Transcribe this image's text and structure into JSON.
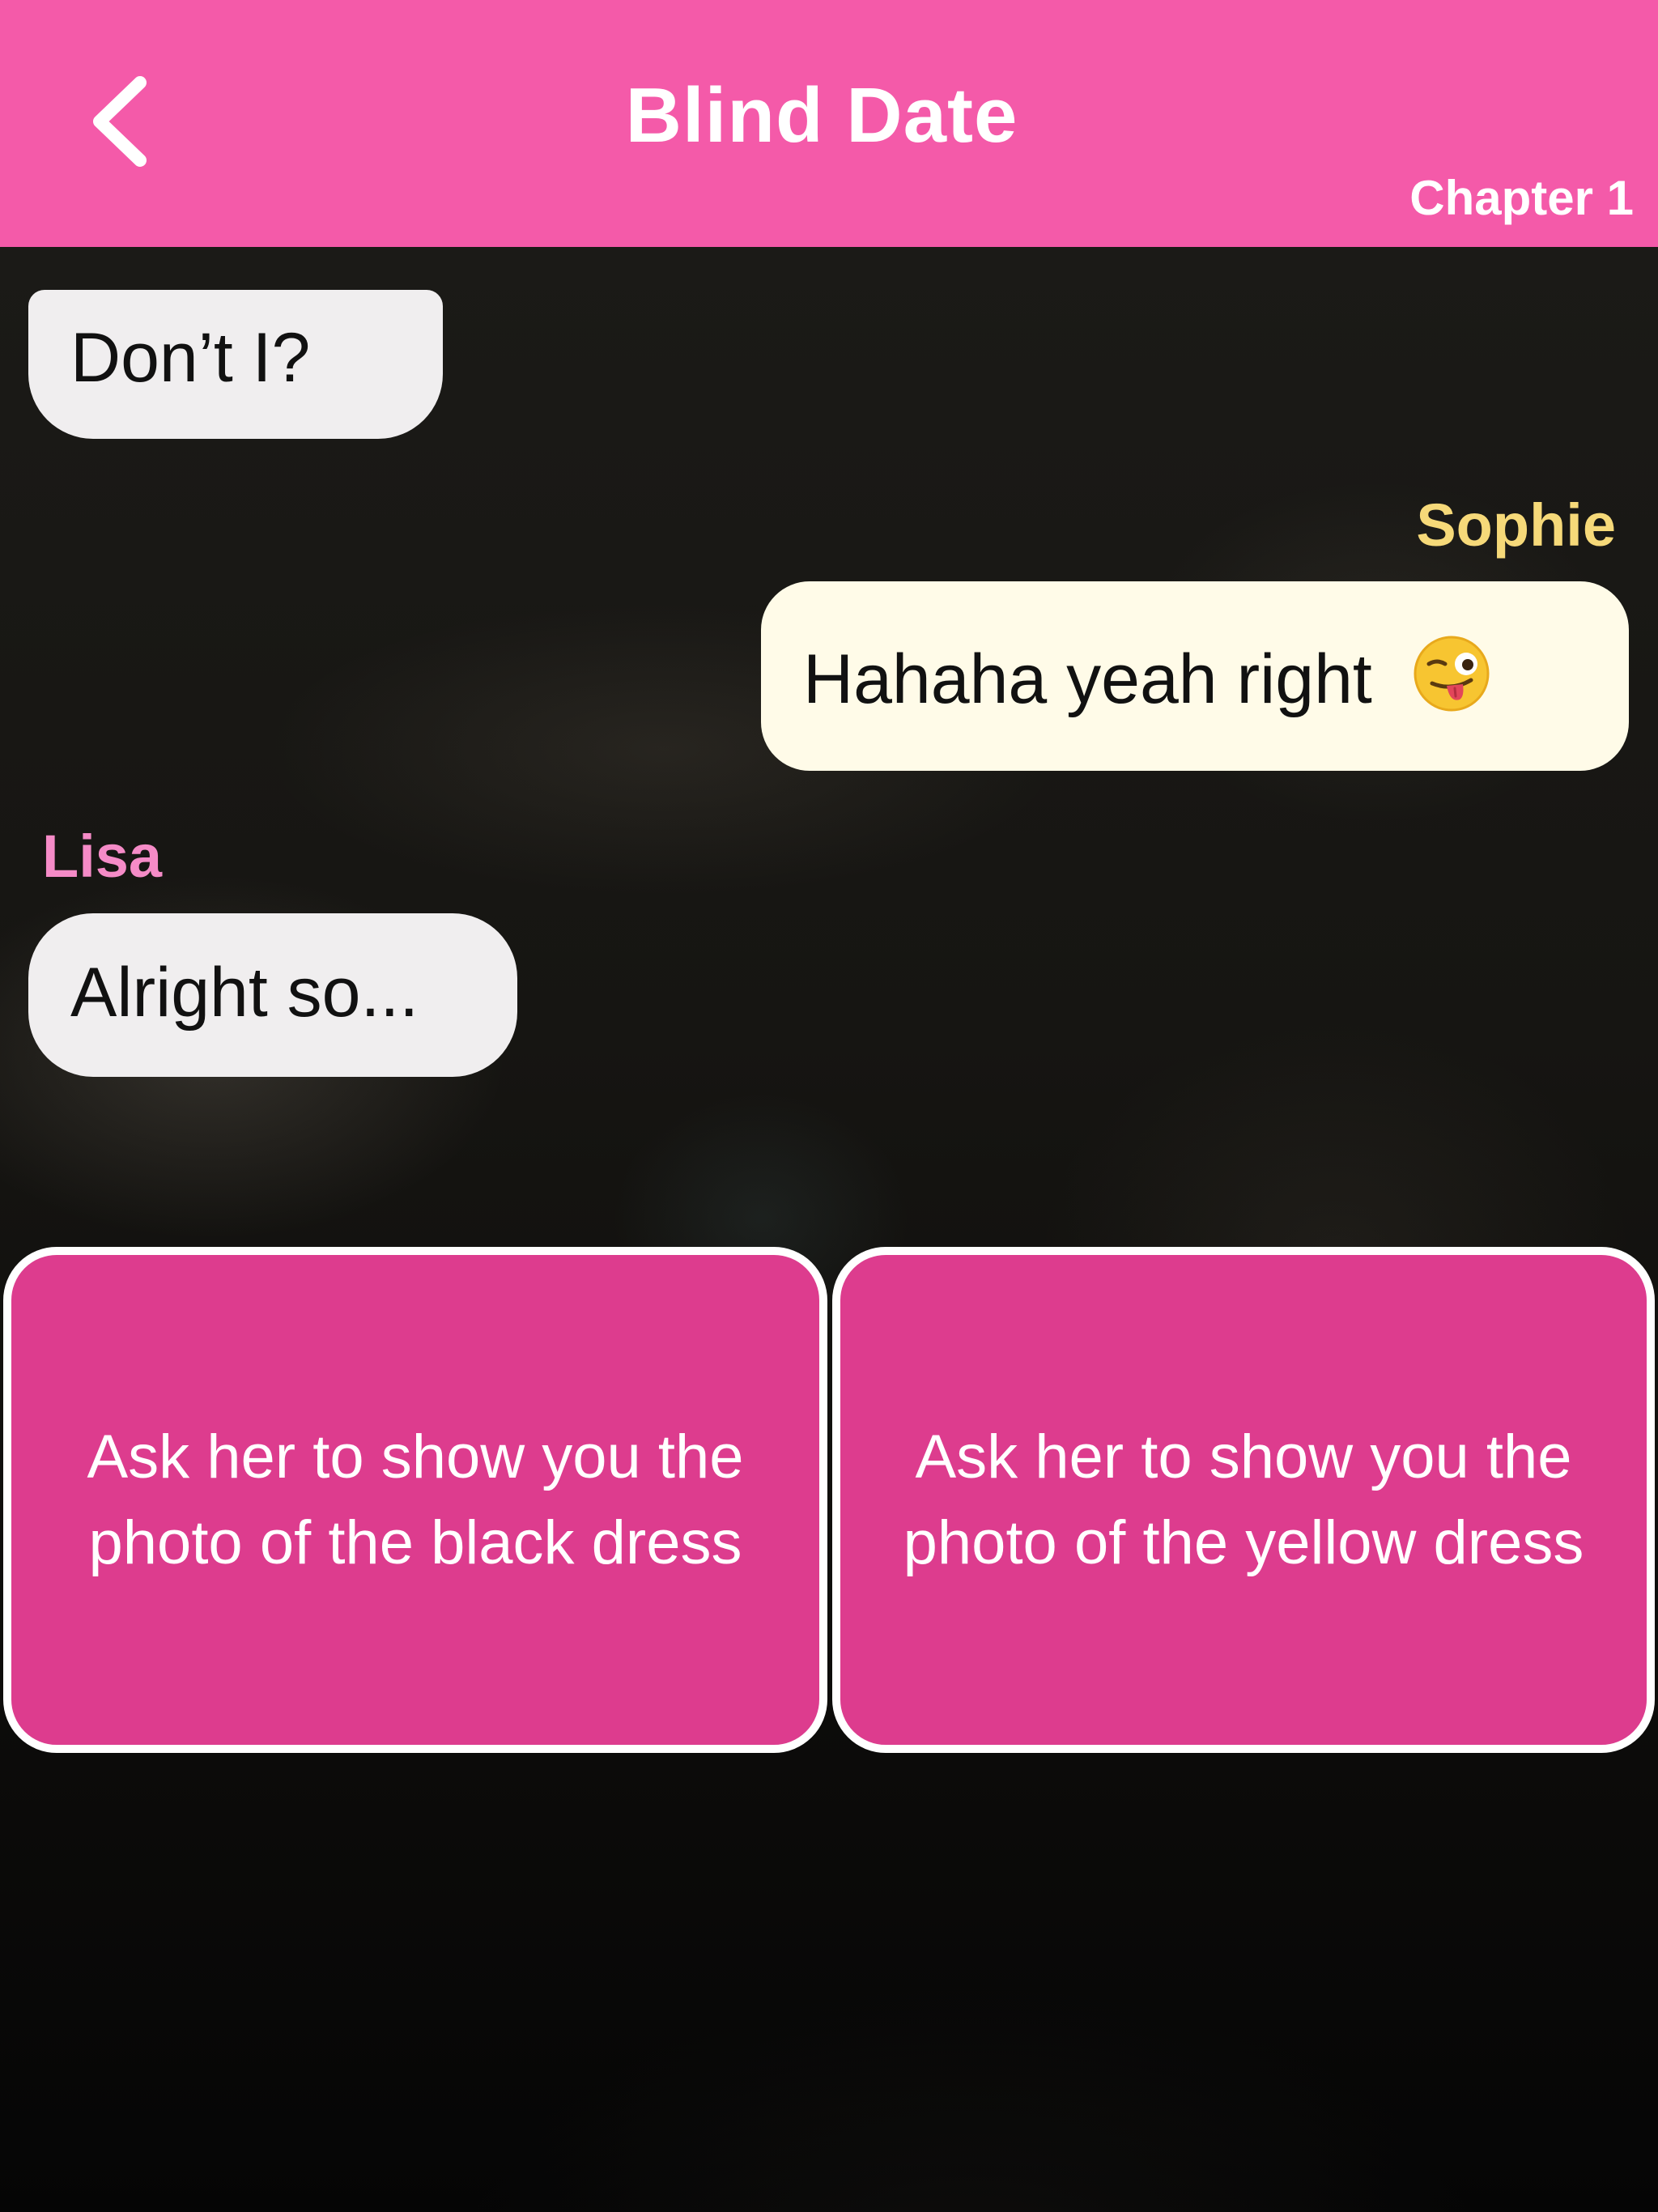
{
  "header": {
    "title": "Blind Date",
    "chapter": "Chapter 1",
    "background_color": "#f45aa9"
  },
  "chat": {
    "messages": [
      {
        "speaker": "",
        "text": "Don’t I?",
        "side": "left",
        "bubble_color": "#f0eeef"
      },
      {
        "speaker": "Sophie",
        "text": "Hahaha yeah right",
        "emoji": "winking-face-with-tongue",
        "side": "right",
        "bubble_color": "#fffbe8",
        "speaker_color": "#f6d979"
      },
      {
        "speaker": "Lisa",
        "text": "Alright so...",
        "side": "left",
        "bubble_color": "#f0eeef",
        "speaker_color": "#f58bc7"
      }
    ]
  },
  "choices": [
    {
      "label": "Ask her to show you the photo of the black dress"
    },
    {
      "label": "Ask her to show you the photo of the yellow dress"
    }
  ],
  "colors": {
    "choice_fill": "#dd3c8e",
    "choice_border": "#ffffff"
  }
}
